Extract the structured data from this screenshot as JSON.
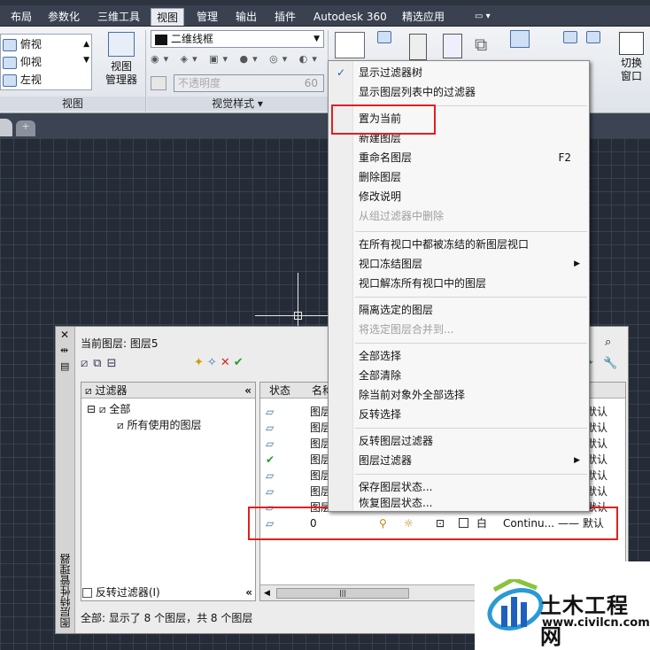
{
  "ribbon_tabs": [
    "布局",
    "参数化",
    "三维工具",
    "视图",
    "管理",
    "输出",
    "插件",
    "Autodesk 360",
    "精选应用"
  ],
  "ribbon": {
    "view_items": [
      "俯视",
      "仰视",
      "左视"
    ],
    "view_manager_label": "视图\n管理器",
    "views_panel_title": "视图",
    "visual_style_combo": "二维线框",
    "opacity_placeholder": "不透明度",
    "opacity_value": "60",
    "visual_styles_panel_title": "视觉样式",
    "switch_window_label": "切换\n窗口"
  },
  "layer_manager": {
    "current_layer": "当前图层: 图层5",
    "filters_header": "过滤器",
    "tree": {
      "all": "全部",
      "all_used": "所有使用的图层"
    },
    "invert_filter_label": "反转过滤器(I)",
    "columns": {
      "status": "状态",
      "name": "名称"
    },
    "rows": [
      {
        "name": "图层",
        "tail": "默认"
      },
      {
        "name": "图层",
        "tail": "默认"
      },
      {
        "name": "图层",
        "tail": "默认"
      },
      {
        "name": "图层",
        "tail": "默认"
      },
      {
        "name": "图层",
        "tail": "默认"
      },
      {
        "name": "图层",
        "tail": "默认"
      },
      {
        "name": "图层",
        "tail": "默认"
      },
      {
        "name": "0",
        "color": "白",
        "linetype": "Continu...",
        "lineweight": "—— 默认"
      }
    ],
    "status_bar": "全部: 显示了 8 个图层，共 8 个图层",
    "vertical_title": "图层特性管理器"
  },
  "context_menu": {
    "items": [
      {
        "label": "显示过滤器树",
        "checked": true
      },
      {
        "label": "显示图层列表中的过滤器"
      },
      {
        "label": "置为当前"
      },
      {
        "label": "新建图层"
      },
      {
        "label": "重命名图层",
        "shortcut": "F2"
      },
      {
        "label": "删除图层"
      },
      {
        "label": "修改说明"
      },
      {
        "label": "从组过滤器中删除",
        "disabled": true
      },
      {
        "label": "在所有视口中都被冻结的新图层视口"
      },
      {
        "label": "视口冻结图层",
        "submenu": true
      },
      {
        "label": "视口解冻所有视口中的图层"
      },
      {
        "label": "隔离选定的图层"
      },
      {
        "label": "将选定图层合并到...",
        "disabled": true
      },
      {
        "label": "全部选择"
      },
      {
        "label": "全部清除"
      },
      {
        "label": "除当前对象外全部选择"
      },
      {
        "label": "反转选择"
      },
      {
        "label": "反转图层过滤器"
      },
      {
        "label": "图层过滤器",
        "submenu": true
      },
      {
        "label": "保存图层状态..."
      },
      {
        "label": "恢复图层状态..."
      }
    ]
  },
  "watermark": {
    "title": "土木工程网",
    "url": "www.civilcn.com"
  },
  "colors": {
    "highlight": "#e02020",
    "accent": "#1f5fbf"
  }
}
